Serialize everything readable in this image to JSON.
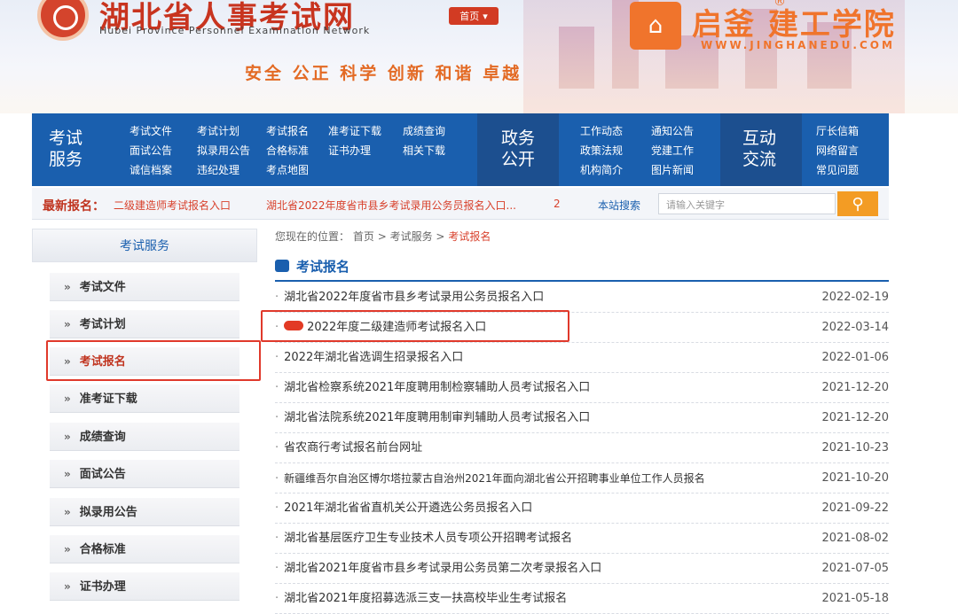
{
  "header": {
    "site_title": "湖北省人事考试网",
    "site_subtitle": "Hubei Province Personnel Examination Network",
    "home_button": "首页",
    "slogan": "安全  公正  科学  创新  和谐  卓越"
  },
  "watermark": {
    "brand": "启釜 建工学院",
    "reg": "®",
    "url": "WWW.JINGHANEDU.COM"
  },
  "nav": {
    "sections": [
      {
        "title": "考试服务",
        "links": [
          "考试文件",
          "考试计划",
          "考试报名",
          "准考证下载",
          "成绩查询",
          "面试公告",
          "拟录用公告",
          "合格标准",
          "证书办理",
          "相关下载",
          "诚信档案",
          "违纪处理",
          "考点地图"
        ]
      },
      {
        "title": "政务公开",
        "links": [
          "工作动态",
          "通知公告",
          "政策法规",
          "党建工作",
          "机构简介",
          "图片新闻"
        ]
      },
      {
        "title": "互动交流",
        "links": [
          "厅长信箱",
          "网络留言",
          "常见问题"
        ]
      }
    ]
  },
  "latest": {
    "label": "最新报名：",
    "items": [
      "二级建造师考试报名入口",
      "湖北省2022年度省市县乡考试录用公务员报名入口..."
    ],
    "more": "2",
    "site_search_label": "本站搜索",
    "search_placeholder": "请输入关键字"
  },
  "sidebar": {
    "title": "考试服务",
    "items": [
      "考试文件",
      "考试计划",
      "考试报名",
      "准考证下载",
      "成绩查询",
      "面试公告",
      "拟录用公告",
      "合格标准",
      "证书办理"
    ],
    "arrow": "»"
  },
  "breadcrumb": {
    "prefix": "您现在的位置：",
    "home": "首页",
    "sep": ">",
    "level1": "考试服务",
    "current": "考试报名"
  },
  "section_title": "考试报名",
  "list": [
    {
      "title": "湖北省2022年度省市县乡考试录用公务员报名入口",
      "date": "2022-02-19"
    },
    {
      "title": "2022年度二级建造师考试报名入口",
      "date": "2022-03-14",
      "hot": true
    },
    {
      "title": "2022年湖北省选调生招录报名入口",
      "date": "2022-01-06"
    },
    {
      "title": "湖北省检察系统2021年度聘用制检察辅助人员考试报名入口",
      "date": "2021-12-20"
    },
    {
      "title": "湖北省法院系统2021年度聘用制审判辅助人员考试报名入口",
      "date": "2021-12-20"
    },
    {
      "title": "省农商行考试报名前台网址",
      "date": "2021-10-23"
    },
    {
      "title": "新疆维吾尔自治区博尔塔拉蒙古自治州2021年面向湖北省公开招聘事业单位工作人员报名",
      "date": "2021-10-20"
    },
    {
      "title": "2021年湖北省省直机关公开遴选公务员报名入口",
      "date": "2021-09-22"
    },
    {
      "title": "湖北省基层医疗卫生专业技术人员专项公开招聘考试报名",
      "date": "2021-08-02"
    },
    {
      "title": "湖北省2021年度省市县乡考试录用公务员第二次考录报名入口",
      "date": "2021-07-05"
    },
    {
      "title": "湖北省2021年度招募选派三支一扶高校毕业生考试报名",
      "date": "2021-05-18"
    }
  ],
  "colors": {
    "brand_red": "#c8341f",
    "nav_blue": "#1a5fae",
    "highlight": "#e0392b",
    "accent_orange": "#f39c24"
  }
}
